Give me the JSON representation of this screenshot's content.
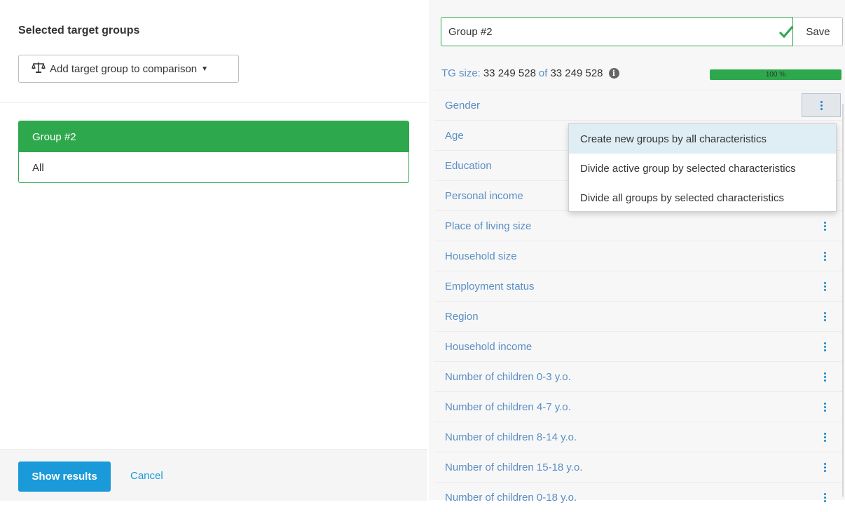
{
  "left": {
    "title": "Selected target groups",
    "add_button_label": "Add target group to comparison",
    "group_card": {
      "name": "Group #2",
      "subtitle": "All"
    },
    "show_results_label": "Show results",
    "cancel_label": "Cancel"
  },
  "right": {
    "group_name_value": "Group #2",
    "save_label": "Save",
    "tg_size_label": "TG size:",
    "tg_size_value": "33 249 528",
    "tg_of_label": "of",
    "tg_total_value": "33 249 528",
    "progress_percent": 100,
    "progress_text": "100 %",
    "characteristics": [
      {
        "label": "Gender"
      },
      {
        "label": "Age"
      },
      {
        "label": "Education"
      },
      {
        "label": "Personal income"
      },
      {
        "label": "Place of living size"
      },
      {
        "label": "Household size"
      },
      {
        "label": "Employment status"
      },
      {
        "label": "Region"
      },
      {
        "label": "Household income"
      },
      {
        "label": "Number of children 0-3 y.o."
      },
      {
        "label": "Number of children 4-7 y.o."
      },
      {
        "label": "Number of children 8-14 y.o."
      },
      {
        "label": "Number of children 15-18 y.o."
      },
      {
        "label": "Number of children 0-18 y.o."
      }
    ],
    "menu": {
      "items": [
        {
          "label": "Create new groups by all characteristics"
        },
        {
          "label": "Divide active group by selected characteristics"
        },
        {
          "label": "Divide all groups by selected characteristics"
        }
      ]
    }
  },
  "colors": {
    "green": "#2ea84c",
    "blue": "#1b9ad9",
    "link": "#5b8ec4"
  },
  "icons": {
    "add_button": "scales-icon",
    "name_field": "checkmark-icon",
    "tg_info": "info-icon",
    "row_action": "kebab-menu-icon"
  }
}
